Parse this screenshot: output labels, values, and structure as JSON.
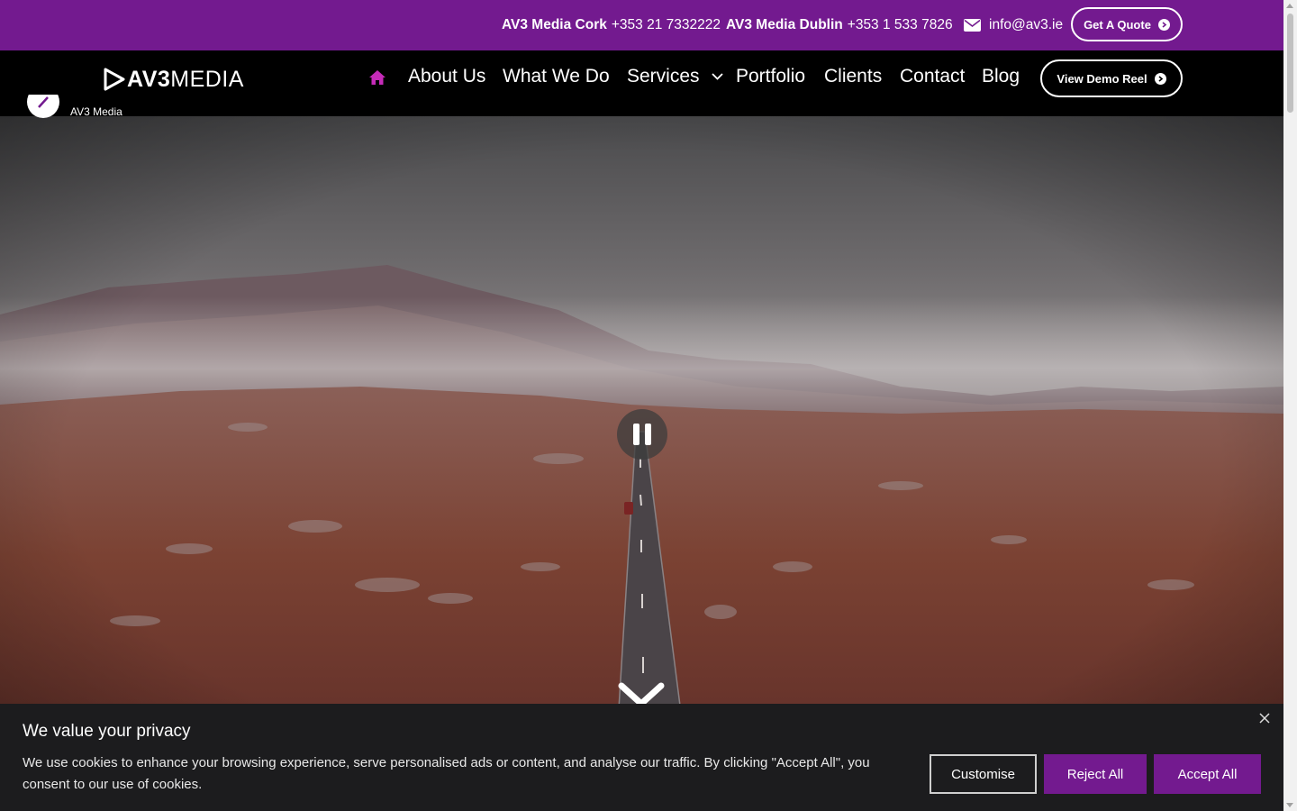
{
  "topbar": {
    "cork_label": "AV3 Media Cork",
    "cork_phone": "+353 21 7332222",
    "dublin_label": "AV3 Media Dublin",
    "dublin_phone": "+353 1 533 7826",
    "email": "info@av3.ie",
    "quote_button": "Get A Quote",
    "background_color": "#731a8f"
  },
  "nav": {
    "logo_bold": "AV3",
    "logo_light": "MEDIA",
    "home_icon": "home-icon",
    "home_icon_color": "#c52bb8",
    "items": [
      "About Us",
      "What We Do",
      "Services",
      "Portfolio",
      "Clients",
      "Contact",
      "Blog"
    ],
    "demo_button": "View Demo Reel"
  },
  "hero": {
    "channel_name": "AV3 Media",
    "pause_icon": "pause-icon",
    "scroll_icon": "chevron-down-icon"
  },
  "cookie": {
    "title": "We value your privacy",
    "text": "We use cookies to enhance your browsing experience, serve personalised ads or content, and analyse our traffic. By clicking \"Accept All\", you consent to our use of cookies.",
    "customise": "Customise",
    "reject": "Reject All",
    "accept": "Accept All",
    "close_icon": "close-icon",
    "button_color": "#731a8f"
  }
}
